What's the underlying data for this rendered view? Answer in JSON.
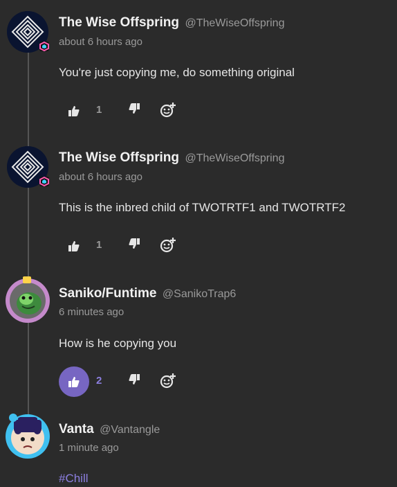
{
  "comments": [
    {
      "user": "The Wise Offspring",
      "handle": "@TheWiseOffspring",
      "time": "about 6 hours ago",
      "text": "You're just copying me, do something original",
      "likes": "1",
      "liked": false
    },
    {
      "user": "The Wise Offspring",
      "handle": "@TheWiseOffspring",
      "time": "about 6 hours ago",
      "text": "This is the inbred child of TWOTRTF1 and TWOTRTF2",
      "likes": "1",
      "liked": false
    },
    {
      "user": "Saniko/Funtime",
      "handle": "@SanikoTrap6",
      "time": "6 minutes ago",
      "text": "How is he copying you",
      "likes": "2",
      "liked": true
    },
    {
      "user": "Vanta",
      "handle": "@Vantangle",
      "time": "1 minute ago",
      "text": "#Chill"
    }
  ],
  "colors": {
    "background": "#2b2b2b",
    "accent": "#7766c2",
    "muted": "#9a9a9a"
  },
  "icons": [
    "thumbs-up-icon",
    "thumbs-down-icon",
    "add-reaction-icon"
  ]
}
